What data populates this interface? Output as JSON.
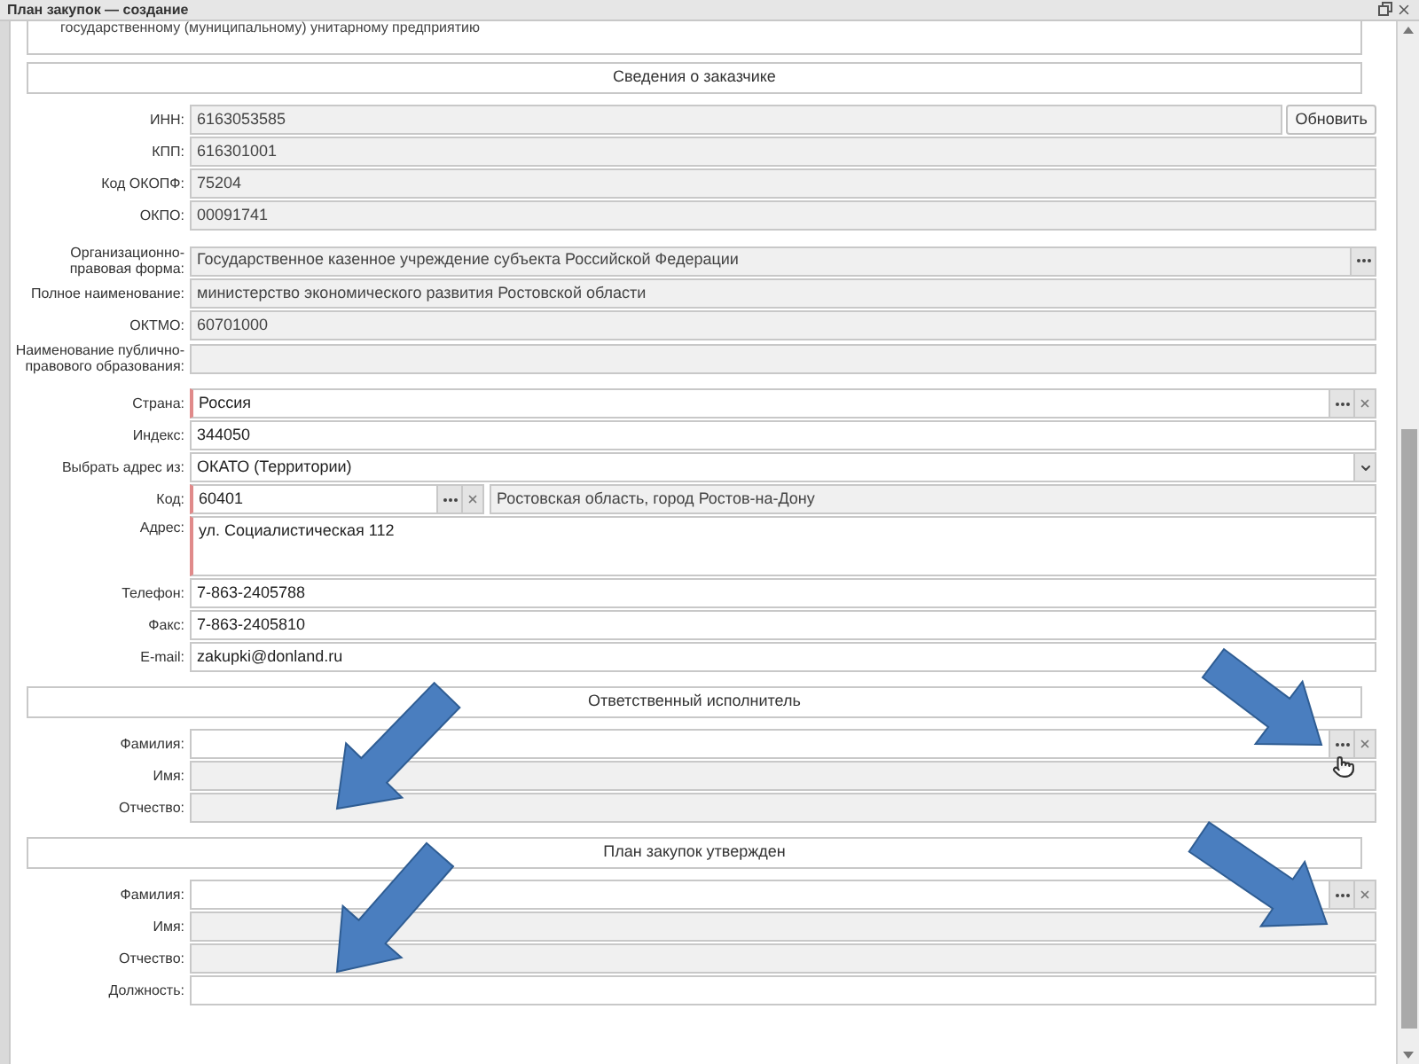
{
  "window": {
    "title": "План закупок — создание"
  },
  "top_note": "государственному (муниципальному) унитарному предприятию",
  "sections": [
    {
      "title": "Сведения о заказчике",
      "groups": [
        {
          "fields": [
            {
              "kind": "line",
              "label": "ИНН:",
              "value": "6163053585",
              "disabled": true,
              "required": false,
              "button": "Обновить"
            },
            {
              "kind": "line",
              "label": "КПП:",
              "value": "616301001",
              "disabled": true,
              "required": false
            },
            {
              "kind": "line",
              "label": "Код ОКОПФ:",
              "value": "75204",
              "disabled": true,
              "required": false
            },
            {
              "kind": "line",
              "label": "ОКПО:",
              "value": "00091741",
              "disabled": true,
              "required": false
            }
          ]
        },
        {
          "fields": [
            {
              "kind": "tall",
              "label": "Организационно-правовая форма:",
              "value": "Государственное казенное учреждение субъекта Российской Федерации",
              "disabled": true,
              "required": false,
              "controls": [
                {
                  "kind": "picker"
                }
              ]
            },
            {
              "kind": "line",
              "label": "Полное наименование:",
              "value": "министерство экономического развития Ростовской области",
              "disabled": true,
              "required": false
            },
            {
              "kind": "line",
              "label": "ОКТМО:",
              "value": "60701000",
              "disabled": true,
              "required": false
            },
            {
              "kind": "tall",
              "label": "Наименование публично-правового образования:",
              "disabled": true,
              "required": false
            }
          ]
        },
        {
          "fields": [
            {
              "kind": "line",
              "label": "Страна:",
              "value": "Россия",
              "disabled": false,
              "required": true,
              "controls": [
                {
                  "kind": "picker"
                },
                {
                  "kind": "clear"
                }
              ]
            },
            {
              "kind": "line",
              "label": "Индекс:",
              "value": "344050",
              "disabled": false,
              "required": false
            },
            {
              "kind": "line",
              "label": "Выбрать адрес из:",
              "value": "ОКАТО (Территории)",
              "disabled": false,
              "required": false,
              "controls": [
                {
                  "kind": "dropdown"
                }
              ]
            },
            {
              "kind": "code",
              "label": "Код:",
              "value": "60401",
              "disabled": false,
              "required": true,
              "controls": [
                {
                  "kind": "picker"
                },
                {
                  "kind": "clear"
                }
              ],
              "description": "Ростовская область, город Ростов-на-Дону"
            },
            {
              "kind": "area",
              "label": "Адрес:",
              "value": "ул. Социалистическая 112",
              "disabled": false,
              "required": true
            },
            {
              "kind": "line",
              "label": "Телефон:",
              "value": "7-863-2405788",
              "disabled": false,
              "required": false
            },
            {
              "kind": "line",
              "label": "Факс:",
              "value": "7-863-2405810",
              "disabled": false,
              "required": false
            },
            {
              "kind": "line",
              "label": "E-mail:",
              "value": "zakupki@donland.ru",
              "disabled": false,
              "required": false
            }
          ]
        }
      ]
    },
    {
      "title": "Ответственный исполнитель",
      "groups": [
        {
          "fields": [
            {
              "kind": "line",
              "label": "Фамилия:",
              "disabled": false,
              "required": false,
              "controls": [
                {
                  "kind": "picker"
                },
                {
                  "kind": "clear"
                }
              ]
            },
            {
              "kind": "line",
              "label": "Имя:",
              "disabled": true,
              "required": false
            },
            {
              "kind": "line",
              "label": "Отчество:",
              "disabled": true,
              "required": false
            }
          ]
        }
      ]
    },
    {
      "title": "План закупок утвержден",
      "groups": [
        {
          "fields": [
            {
              "kind": "line",
              "label": "Фамилия:",
              "disabled": false,
              "required": false,
              "controls": [
                {
                  "kind": "picker"
                },
                {
                  "kind": "clear"
                }
              ]
            },
            {
              "kind": "line",
              "label": "Имя:",
              "disabled": true,
              "required": false
            },
            {
              "kind": "line",
              "label": "Отчество:",
              "disabled": true,
              "required": false
            },
            {
              "kind": "line",
              "label": "Должность:",
              "disabled": false,
              "required": false
            }
          ]
        }
      ]
    }
  ]
}
